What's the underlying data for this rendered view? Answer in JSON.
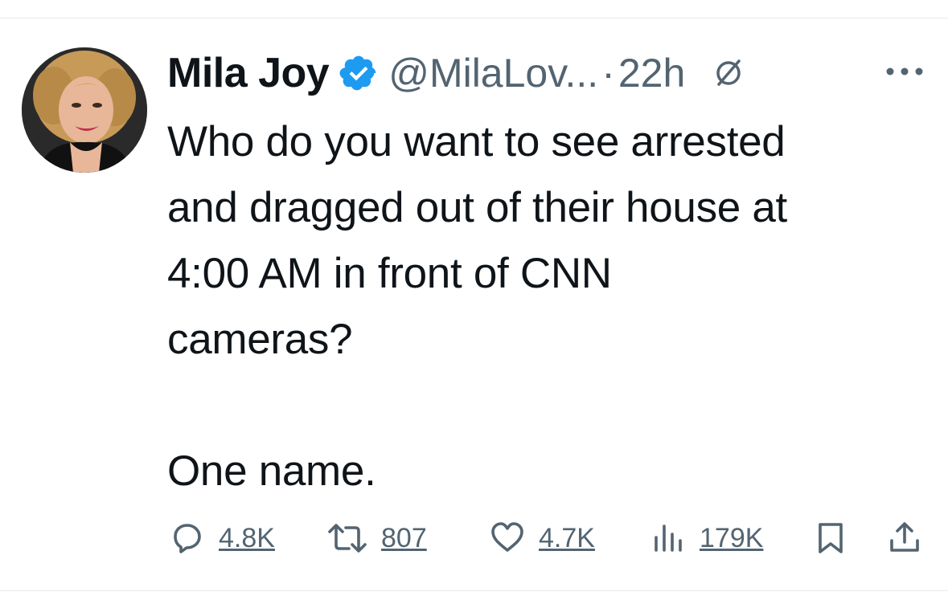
{
  "tweet": {
    "author_name": "Mila Joy",
    "handle": "@MilaLov...",
    "separator": "·",
    "time": "22h",
    "body": "Who do you want to see arrested\nand dragged out of their house at\n4:00 AM in front of CNN\ncameras?\n\nOne name."
  },
  "metrics": {
    "replies": "4.8K",
    "reposts": "807",
    "likes": "4.7K",
    "views": "179K"
  },
  "icons": {
    "verified": "verified-badge-icon",
    "grok": "grok-icon",
    "more": "more-icon",
    "reply": "reply-icon",
    "repost": "repost-icon",
    "like": "heart-icon",
    "views": "views-chart-icon",
    "bookmark": "bookmark-icon",
    "share": "share-icon"
  },
  "colors": {
    "text": "#0f1419",
    "secondary": "#536471",
    "verified": "#1d9bf0",
    "divider": "#e6e9ec"
  }
}
